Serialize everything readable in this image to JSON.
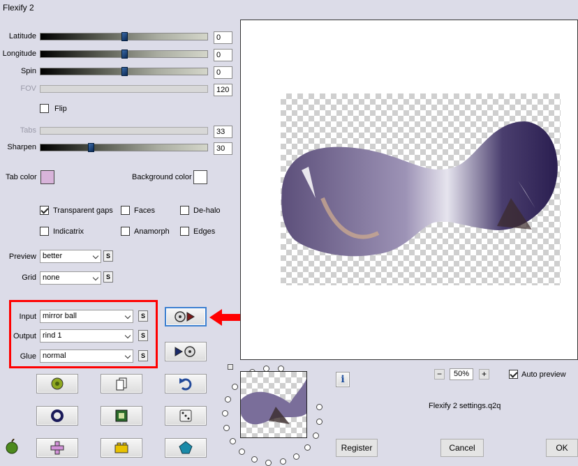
{
  "window": {
    "title": "Flexify 2"
  },
  "sliders": [
    {
      "label": "Latitude",
      "value": "0",
      "disabled": false,
      "pos": 0.5
    },
    {
      "label": "Longitude",
      "value": "0",
      "disabled": false,
      "pos": 0.5
    },
    {
      "label": "Spin",
      "value": "0",
      "disabled": false,
      "pos": 0.5
    },
    {
      "label": "FOV",
      "value": "120",
      "disabled": true
    },
    {
      "label": "Tabs",
      "value": "33",
      "disabled": true
    },
    {
      "label": "Sharpen",
      "value": "30",
      "disabled": false,
      "pos": 0.3
    }
  ],
  "flip": {
    "label": "Flip",
    "checked": false
  },
  "colors": {
    "tab_label": "Tab color",
    "tab_value": "#d8b4da",
    "bg_label": "Background color",
    "bg_value": "#ffffff",
    "highlight_box": "#ff0000",
    "arrow": "#ff0000"
  },
  "options": {
    "transparent_gaps": {
      "label": "Transparent gaps",
      "checked": true
    },
    "faces": {
      "label": "Faces",
      "checked": false
    },
    "dehalo": {
      "label": "De-halo",
      "checked": false
    },
    "indicatrix": {
      "label": "Indicatrix",
      "checked": false
    },
    "anamorph": {
      "label": "Anamorph",
      "checked": false
    },
    "edges": {
      "label": "Edges",
      "checked": false
    }
  },
  "selects": {
    "preview": {
      "label": "Preview",
      "value": "better"
    },
    "grid": {
      "label": "Grid",
      "value": "none"
    },
    "input": {
      "label": "Input",
      "value": "mirror ball"
    },
    "output": {
      "label": "Output",
      "value": "rind 1"
    },
    "glue": {
      "label": "Glue",
      "value": "normal"
    },
    "s_label": "S"
  },
  "zoom": {
    "minus": "−",
    "value": "50%",
    "plus": "+"
  },
  "auto_preview": {
    "label": "Auto preview",
    "checked": true
  },
  "settings_file": "Flexify 2 settings.q2q",
  "info_label": "i",
  "buttons": {
    "register": "Register",
    "cancel": "Cancel",
    "ok": "OK"
  }
}
